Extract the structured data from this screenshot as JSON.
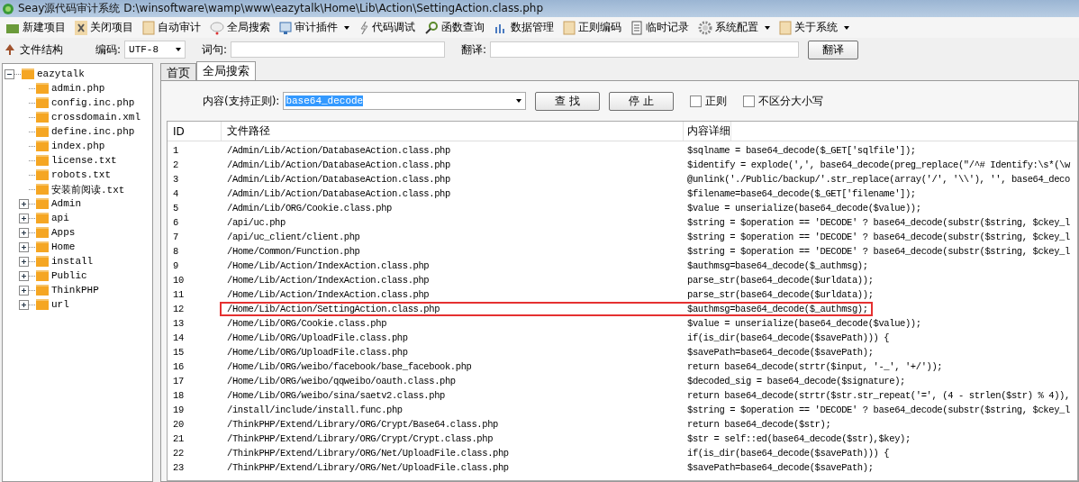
{
  "window": {
    "title": "Seay源代码审计系统  D:\\winsoftware\\wamp\\www\\eazytalk\\Home\\Lib\\Action\\SettingAction.class.php"
  },
  "toolbar": [
    {
      "label": "新建项目",
      "kind": "folder",
      "dropdown": false
    },
    {
      "label": "关闭项目",
      "kind": "close",
      "dropdown": false
    },
    {
      "label": "自动审计",
      "kind": "doc",
      "dropdown": false
    },
    {
      "label": "全局搜索",
      "kind": "bubble",
      "dropdown": false
    },
    {
      "label": "审计插件",
      "kind": "monitor",
      "dropdown": true
    },
    {
      "label": "代码调试",
      "kind": "bolt",
      "dropdown": false
    },
    {
      "label": "函数查询",
      "kind": "search",
      "dropdown": false
    },
    {
      "label": "数据管理",
      "kind": "chart",
      "dropdown": false
    },
    {
      "label": "正则编码",
      "kind": "doc",
      "dropdown": false
    },
    {
      "label": "临时记录",
      "kind": "page",
      "dropdown": false
    },
    {
      "label": "系统配置",
      "kind": "gear",
      "dropdown": true
    },
    {
      "label": "关于系统",
      "kind": "doc",
      "dropdown": true
    }
  ],
  "secondbar": {
    "tree_label": "文件结构",
    "encoding_label": "编码:",
    "encoding_value": "UTF-8",
    "word_label": "词句:",
    "translate_label": "翻译:",
    "translate_button": "翻译"
  },
  "tree": [
    {
      "label": "eazytalk",
      "expanded": true,
      "children": [
        {
          "label": "admin.php"
        },
        {
          "label": "config.inc.php"
        },
        {
          "label": "crossdomain.xml"
        },
        {
          "label": "define.inc.php"
        },
        {
          "label": "index.php"
        },
        {
          "label": "license.txt"
        },
        {
          "label": "robots.txt"
        },
        {
          "label": "安装前阅读.txt"
        },
        {
          "label": "Admin",
          "expanded": false
        },
        {
          "label": "api",
          "expanded": false
        },
        {
          "label": "Apps",
          "expanded": false
        },
        {
          "label": "Home",
          "expanded": false
        },
        {
          "label": "install",
          "expanded": false
        },
        {
          "label": "Public",
          "expanded": false
        },
        {
          "label": "ThinkPHP",
          "expanded": false
        },
        {
          "label": "url",
          "expanded": false
        }
      ]
    }
  ],
  "tabs": [
    {
      "label": "首页",
      "selected": false
    },
    {
      "label": "全局搜索",
      "selected": true
    }
  ],
  "search": {
    "label": "内容(支持正则):",
    "value": "base64_decode",
    "find_button": "查 找",
    "stop_button": "停 止",
    "options": [
      {
        "label": "正则",
        "checked": false
      },
      {
        "label": "不区分大小写",
        "checked": false
      }
    ]
  },
  "table": {
    "columns": [
      "ID",
      "文件路径",
      "内容详细"
    ],
    "rows": [
      {
        "id": "1",
        "path": "/Admin/Lib/Action/DatabaseAction.class.php",
        "content": "$sqlname = base64_decode($_GET['sqlfile']);",
        "highlighted": false
      },
      {
        "id": "2",
        "path": "/Admin/Lib/Action/DatabaseAction.class.php",
        "content": "$identify = explode(',', base64_decode(preg_replace(\"/^# Identify:\\s*(\\w",
        "highlighted": false
      },
      {
        "id": "3",
        "path": "/Admin/Lib/Action/DatabaseAction.class.php",
        "content": "@unlink('./Public/backup/'.str_replace(array('/', '\\\\'), '', base64_deco",
        "highlighted": false
      },
      {
        "id": "4",
        "path": "/Admin/Lib/Action/DatabaseAction.class.php",
        "content": "$filename=base64_decode($_GET['filename']);",
        "highlighted": false
      },
      {
        "id": "5",
        "path": "/Admin/Lib/ORG/Cookie.class.php",
        "content": "$value   =   unserialize(base64_decode($value));",
        "highlighted": false
      },
      {
        "id": "6",
        "path": "/api/uc.php",
        "content": "$string = $operation == 'DECODE' ? base64_decode(substr($string, $ckey_l",
        "highlighted": false
      },
      {
        "id": "7",
        "path": "/api/uc_client/client.php",
        "content": "$string = $operation == 'DECODE' ? base64_decode(substr($string, $ckey_l",
        "highlighted": false
      },
      {
        "id": "8",
        "path": "/Home/Common/Function.php",
        "content": "$string = $operation == 'DECODE' ? base64_decode(substr($string, $ckey_l",
        "highlighted": false
      },
      {
        "id": "9",
        "path": "/Home/Lib/Action/IndexAction.class.php",
        "content": "$authmsg=base64_decode($_authmsg);",
        "highlighted": false
      },
      {
        "id": "10",
        "path": "/Home/Lib/Action/IndexAction.class.php",
        "content": "parse_str(base64_decode($urldata));",
        "highlighted": false
      },
      {
        "id": "11",
        "path": "/Home/Lib/Action/IndexAction.class.php",
        "content": "parse_str(base64_decode($urldata));",
        "highlighted": false
      },
      {
        "id": "12",
        "path": "/Home/Lib/Action/SettingAction.class.php",
        "content": "$authmsg=base64_decode($_authmsg);",
        "highlighted": true
      },
      {
        "id": "13",
        "path": "/Home/Lib/ORG/Cookie.class.php",
        "content": "$value   =   unserialize(base64_decode($value));",
        "highlighted": false
      },
      {
        "id": "14",
        "path": "/Home/Lib/ORG/UploadFile.class.php",
        "content": "if(is_dir(base64_decode($savePath))) {",
        "highlighted": false
      },
      {
        "id": "15",
        "path": "/Home/Lib/ORG/UploadFile.class.php",
        "content": "$savePath=base64_decode($savePath);",
        "highlighted": false
      },
      {
        "id": "16",
        "path": "/Home/Lib/ORG/weibo/facebook/base_facebook.php",
        "content": "return base64_decode(strtr($input, '-_', '+/'));",
        "highlighted": false
      },
      {
        "id": "17",
        "path": "/Home/Lib/ORG/weibo/qqweibo/oauth.class.php",
        "content": "$decoded_sig = base64_decode($signature);",
        "highlighted": false
      },
      {
        "id": "18",
        "path": "/Home/Lib/ORG/weibo/sina/saetv2.class.php",
        "content": "return base64_decode(strtr($str.str_repeat('=',  (4 - strlen($str) % 4)),",
        "highlighted": false
      },
      {
        "id": "19",
        "path": "/install/include/install.func.php",
        "content": "$string = $operation == 'DECODE' ? base64_decode(substr($string, $ckey_l",
        "highlighted": false
      },
      {
        "id": "20",
        "path": "/ThinkPHP/Extend/Library/ORG/Crypt/Base64.class.php",
        "content": "return base64_decode($str);",
        "highlighted": false
      },
      {
        "id": "21",
        "path": "/ThinkPHP/Extend/Library/ORG/Crypt/Crypt.class.php",
        "content": "$str = self::ed(base64_decode($str),$key);",
        "highlighted": false
      },
      {
        "id": "22",
        "path": "/ThinkPHP/Extend/Library/ORG/Net/UploadFile.class.php",
        "content": "if(is_dir(base64_decode($savePath))) {",
        "highlighted": false
      },
      {
        "id": "23",
        "path": "/ThinkPHP/Extend/Library/ORG/Net/UploadFile.class.php",
        "content": "$savePath=base64_decode($savePath);",
        "highlighted": false
      }
    ]
  }
}
